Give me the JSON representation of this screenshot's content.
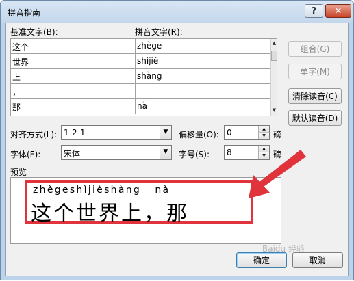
{
  "window": {
    "title": "拼音指南",
    "help_label": "?",
    "close_label": "✕"
  },
  "labels": {
    "base_text": "基准文字(B):",
    "pinyin_text": "拼音文字(R):",
    "alignment": "对齐方式(L):",
    "offset": "偏移量(O):",
    "font": "字体(F):",
    "size": "字号(S):",
    "unit_pt": "磅",
    "preview": "预览"
  },
  "rows": [
    {
      "base": "这个",
      "pinyin": "zhège"
    },
    {
      "base": "世界",
      "pinyin": "shìjiè"
    },
    {
      "base": "上",
      "pinyin": "shàng"
    },
    {
      "base": "，",
      "pinyin": ""
    },
    {
      "base": "那",
      "pinyin": "nà"
    }
  ],
  "buttons": {
    "combine": "组合(G)",
    "single": "单字(M)",
    "clear": "清除读音(C)",
    "default": "默认读音(D)",
    "ok": "确定",
    "cancel": "取消"
  },
  "fields": {
    "alignment_value": "1-2-1",
    "offset_value": "0",
    "font_value": "宋体",
    "size_value": "8"
  },
  "preview": {
    "pinyin": "zhègeshìjièshàng   nà",
    "chars": "这个世界上，那"
  },
  "watermark": "Baidu 经验",
  "colors": {
    "highlight": "#e0333c",
    "arrow": "#e0333c",
    "window_frame": "#bcd3ea"
  }
}
